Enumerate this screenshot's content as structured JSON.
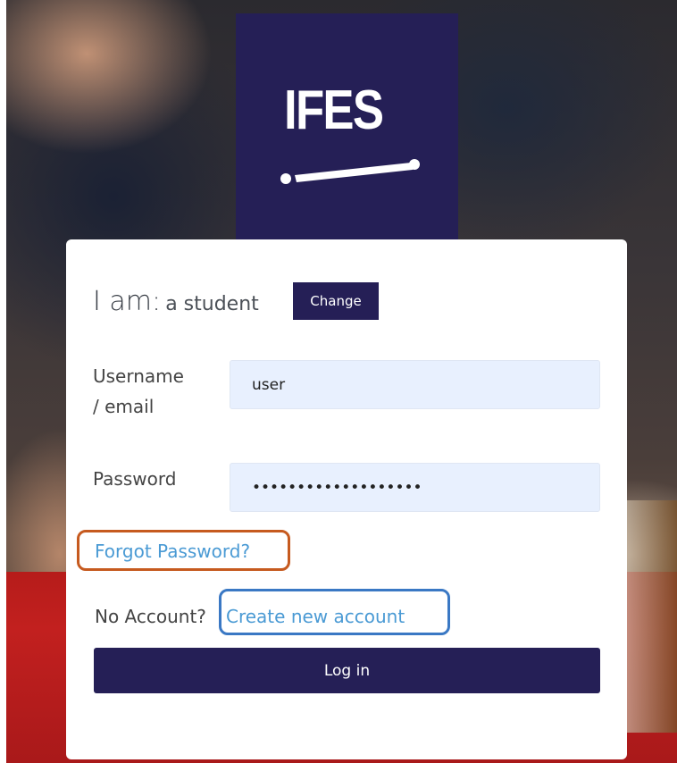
{
  "brand": {
    "logo_text": "IFES",
    "logo_color": "#251f56"
  },
  "role": {
    "prefix": "I am:",
    "value": "a student",
    "change_label": "Change"
  },
  "form": {
    "username_label_line1": "Username",
    "username_label_line2": "/ email",
    "username_value": "user",
    "password_label": "Password",
    "password_value": "•••••••••••••••••••"
  },
  "links": {
    "forgot_password": "Forgot Password?",
    "no_account": "No Account?",
    "create_account": "Create new account"
  },
  "actions": {
    "login_label": "Log in"
  },
  "colors": {
    "link": "#4a9ad4",
    "forgot_highlight": "#c65a1f",
    "create_highlight": "#3a78c4"
  }
}
